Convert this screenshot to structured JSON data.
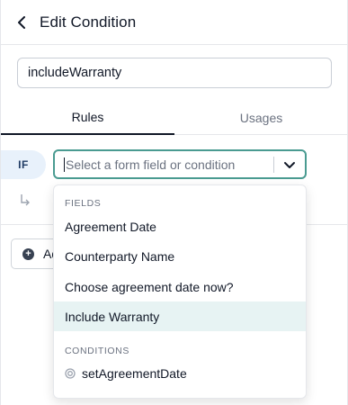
{
  "header": {
    "title": "Edit Condition",
    "back_icon": "chevron-left-icon"
  },
  "condition_name": {
    "value": "includeWarranty"
  },
  "tabs": [
    {
      "label": "Rules",
      "active": true
    },
    {
      "label": "Usages",
      "active": false
    }
  ],
  "rule": {
    "if_label": "IF",
    "select_placeholder": "Select a form field or condition",
    "then_icon": "arrow-return-icon"
  },
  "add_button": {
    "label": "Add",
    "icon": "plus-circle-icon"
  },
  "dropdown": {
    "fields_header": "FIELDS",
    "fields": [
      "Agreement Date",
      "Counterparty Name",
      "Choose agreement date now?",
      "Include Warranty"
    ],
    "highlighted_index": 3,
    "conditions_header": "CONDITIONS",
    "conditions": [
      "setAgreementDate"
    ]
  },
  "colors": {
    "accent": "#4a9b91",
    "if_badge_bg": "#e8f1fb",
    "highlight_bg": "#e7f3f3"
  }
}
